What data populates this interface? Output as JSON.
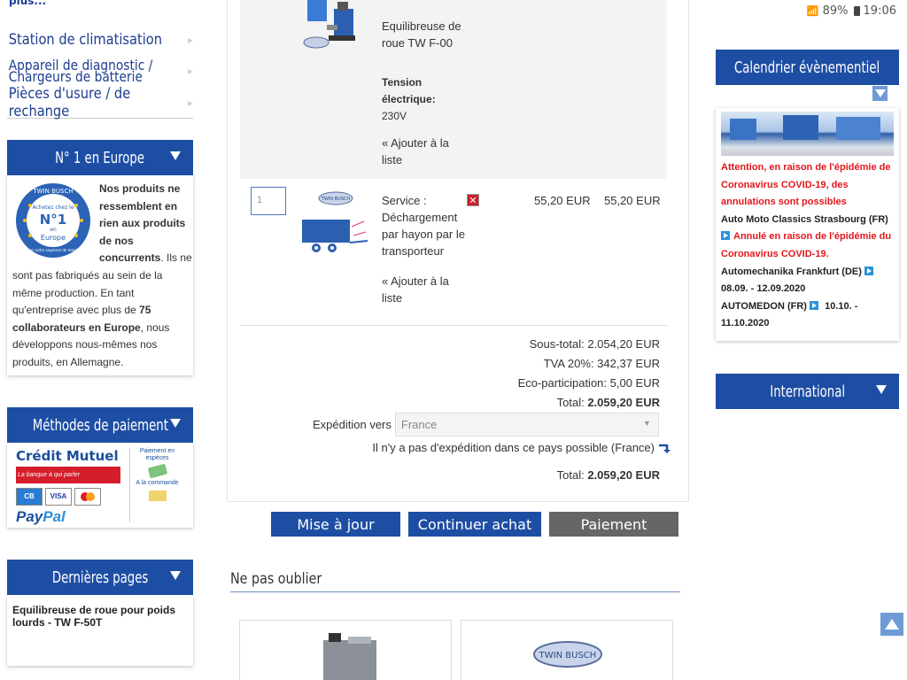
{
  "status_bar": {
    "battery": "89%",
    "time": "19:06"
  },
  "left_nav": {
    "cut_item": "plus...",
    "items": [
      {
        "label": "Station de climatisation"
      },
      {
        "label": "Appareil de diagnostic / Chargeurs de batterie"
      },
      {
        "label": "Pièces d'usure / de rechange"
      }
    ]
  },
  "europe_widget": {
    "title": "N° 1 en Europe",
    "logo_text": [
      "TWIN BUSCH",
      "Achetez chez le",
      "N°1",
      "en",
      "Europe",
      "Dans notre segment de marché"
    ],
    "text_bold_1": "Nos produits ne ressemblent en rien aux produits de nos concurrents",
    "text_1": ". Ils ne sont pas fabriqués au sein de la même production. En tant qu'entreprise avec plus de ",
    "text_bold_2": "75 collaborateurs en Europe",
    "text_2": ", nous développons nous-mêmes nos produits, en Allemagne."
  },
  "payment_widget": {
    "title": "Méthodes de paiement",
    "credit_mutuel": "Crédit Mutuel",
    "credit_mutuel_tagline": "La banque à qui parler",
    "cards": [
      "CB",
      "VISA",
      "MC"
    ],
    "paypal_a": "Pay",
    "paypal_b": "Pal",
    "cash_label": "Paiement en espèces",
    "order_label": "A la commande"
  },
  "recent_widget": {
    "title": "Dernières pages",
    "item": "Equilibreuse de roue pour poids lourds - TW F-50T"
  },
  "cart": {
    "top_item": {
      "name": "Equilibreuse de roue TW F-00",
      "attr_label": "Tension électrique:",
      "attr_value": "230V",
      "add_to_list": "« Ajouter à la liste"
    },
    "service_item": {
      "qty": "1",
      "name": "Service : Déchargement par hayon par le transporteur",
      "unit_price": "55,20 EUR",
      "total_price": "55,20 EUR",
      "add_to_list": "« Ajouter à la liste",
      "logo_text": "TWIN BUSCH"
    },
    "subtotal": "Sous-total: 2.054,20 EUR",
    "vat": "TVA 20%: 342,37 EUR",
    "eco": "Eco-participation: 5,00 EUR",
    "total_label": "Total:",
    "total_value": "2.059,20 EUR",
    "shipping_label": "Expédition vers",
    "shipping_country": "France",
    "shipping_message": "Il n'y a pas d'expédition dans ce pays possible (France)",
    "final_total_label": "Total:",
    "final_total_value": "2.059,20 EUR"
  },
  "buttons": {
    "update": "Mise à jour",
    "continue": "Continuer achat",
    "checkout": "Paiement"
  },
  "related": {
    "title": "Ne pas oublier",
    "logo_text": "TWIN BUSCH"
  },
  "calendar_widget": {
    "title": "Calendrier évènementiel",
    "notice": "Attention, en raison de l'épidémie de Coronavirus COVID-19, des annulations sont possibles",
    "event1": "Auto Moto Classics Strasbourg (FR)",
    "event1_status": "Annulé en raison de l'épidémie du Coronavirus COVID-19.",
    "event2": "Automechanika Frankfurt (DE)",
    "event2_dates": "08.09. - 12.09.2020",
    "event3": "AUTOMEDON (FR)",
    "event3_dates": "10.10. - 11.10.2020"
  },
  "international_widget": {
    "title": "International"
  },
  "colors": {
    "brand_blue": "#1e4ea4",
    "alert_red": "#e2161c",
    "button_grey": "#666666"
  }
}
